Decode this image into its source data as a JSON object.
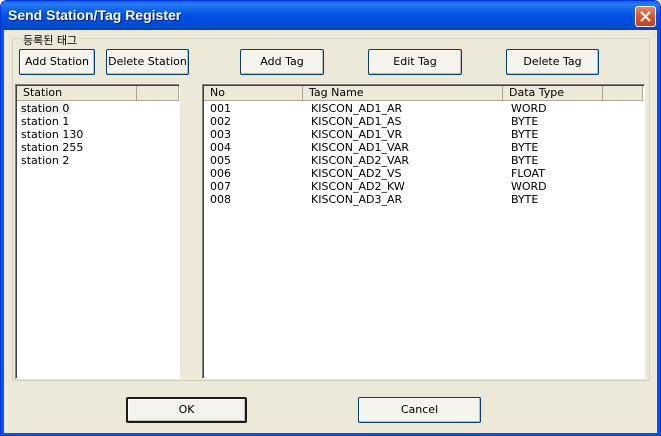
{
  "window": {
    "title": "Send Station/Tag Register"
  },
  "group": {
    "label": "등록된 태그"
  },
  "buttons": {
    "add_station": "Add Station",
    "delete_station": "Delete Station",
    "add_tag": "Add Tag",
    "edit_tag": "Edit Tag",
    "delete_tag": "Delete Tag",
    "ok": "OK",
    "cancel": "Cancel"
  },
  "station_list": {
    "header": "Station",
    "items": [
      "station 0",
      "station 1",
      "station 130",
      "station 255",
      "station 2"
    ],
    "selected_index": 0
  },
  "tag_list": {
    "headers": {
      "no": "No",
      "tag_name": "Tag Name",
      "data_type": "Data Type"
    },
    "rows": [
      {
        "no": "001",
        "tag_name": "KISCON_AD1_AR",
        "data_type": "WORD"
      },
      {
        "no": "002",
        "tag_name": "KISCON_AD1_AS",
        "data_type": "BYTE"
      },
      {
        "no": "003",
        "tag_name": "KISCON_AD1_VR",
        "data_type": "BYTE"
      },
      {
        "no": "004",
        "tag_name": "KISCON_AD1_VAR",
        "data_type": "BYTE"
      },
      {
        "no": "005",
        "tag_name": "KISCON_AD2_VAR",
        "data_type": "BYTE"
      },
      {
        "no": "006",
        "tag_name": "KISCON_AD2_VS",
        "data_type": "FLOAT"
      },
      {
        "no": "007",
        "tag_name": "KISCON_AD2_KW",
        "data_type": "WORD"
      },
      {
        "no": "008",
        "tag_name": "KISCON_AD3_AR",
        "data_type": "BYTE"
      }
    ]
  }
}
